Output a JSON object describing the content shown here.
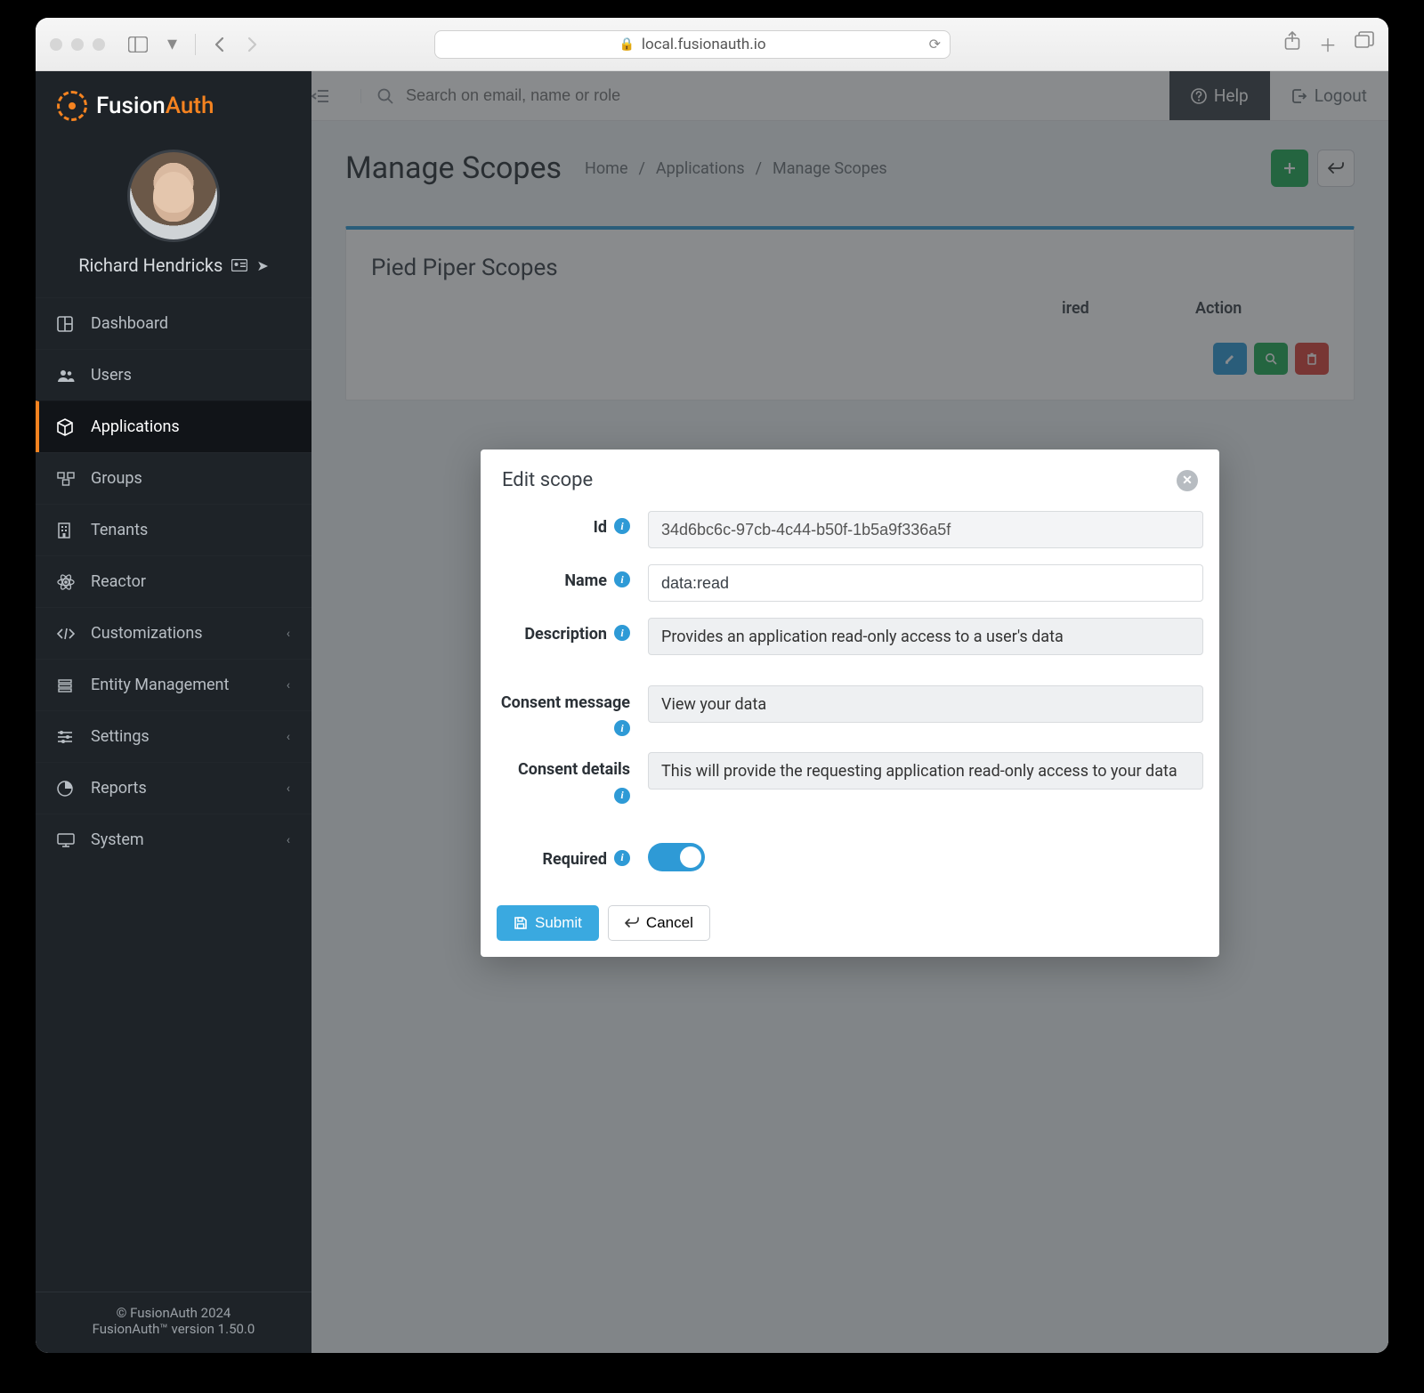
{
  "browser": {
    "url": "local.fusionauth.io"
  },
  "brand": {
    "part1": "Fusion",
    "part2": "Auth"
  },
  "user": {
    "name": "Richard Hendricks"
  },
  "topbar": {
    "search_placeholder": "Search on email, name or role",
    "help": "Help",
    "logout": "Logout"
  },
  "nav": {
    "items": [
      {
        "label": "Dashboard"
      },
      {
        "label": "Users"
      },
      {
        "label": "Applications"
      },
      {
        "label": "Groups"
      },
      {
        "label": "Tenants"
      },
      {
        "label": "Reactor"
      },
      {
        "label": "Customizations"
      },
      {
        "label": "Entity Management"
      },
      {
        "label": "Settings"
      },
      {
        "label": "Reports"
      },
      {
        "label": "System"
      }
    ]
  },
  "footer": {
    "copyright": "© FusionAuth 2024",
    "version": "FusionAuth™ version 1.50.0"
  },
  "page": {
    "title": "Manage Scopes",
    "breadcrumbs": [
      "Home",
      "Applications",
      "Manage Scopes"
    ]
  },
  "panel": {
    "title": "Pied Piper Scopes",
    "columns": {
      "required": "ired",
      "action": "Action"
    }
  },
  "modal": {
    "title": "Edit scope",
    "labels": {
      "id": "Id",
      "name": "Name",
      "description": "Description",
      "consent_message": "Consent message",
      "consent_details": "Consent details",
      "required": "Required"
    },
    "values": {
      "id": "34d6bc6c-97cb-4c44-b50f-1b5a9f336a5f",
      "name": "data:read",
      "description": "Provides an application read-only access to a user's data",
      "consent_message": "View your data",
      "consent_details": "This will provide the requesting application read-only access to your data",
      "required": true
    },
    "buttons": {
      "submit": "Submit",
      "cancel": "Cancel"
    }
  }
}
